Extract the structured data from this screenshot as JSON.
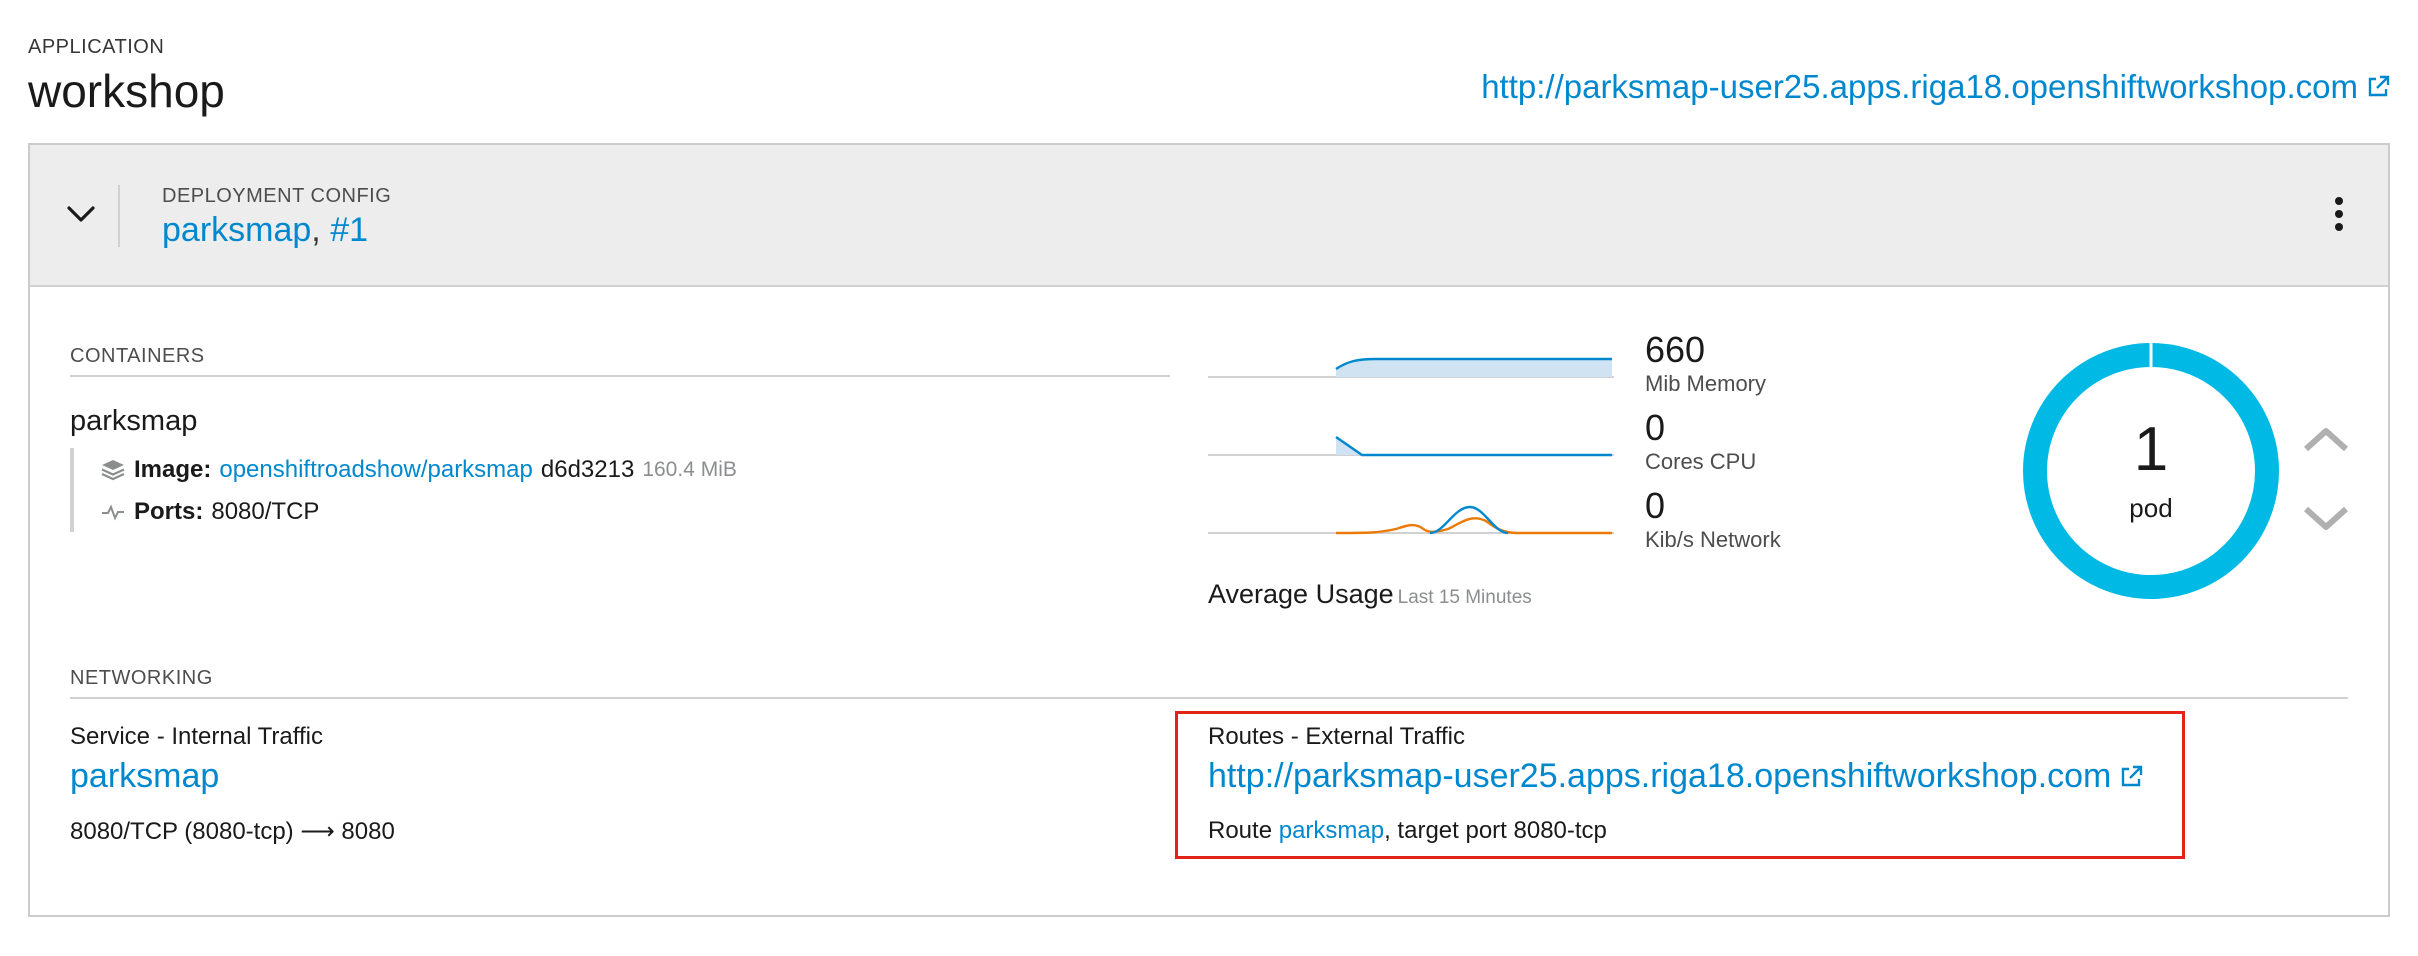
{
  "application": {
    "label": "APPLICATION",
    "name": "workshop",
    "url": "http://parksmap-user25.apps.riga18.openshiftworkshop.com"
  },
  "deployment": {
    "label": "DEPLOYMENT CONFIG",
    "name": "parksmap",
    "separator": ",",
    "revision": "#1"
  },
  "containers": {
    "label": "CONTAINERS",
    "name": "parksmap",
    "image_label": "Image:",
    "image_link": "openshiftroadshow/parksmap",
    "image_hash": "d6d3213",
    "image_size": "160.4 MiB",
    "ports_label": "Ports:",
    "ports_value": "8080/TCP"
  },
  "metrics": [
    {
      "value": "660",
      "unit": "Mib Memory"
    },
    {
      "value": "0",
      "unit": "Cores CPU"
    },
    {
      "value": "0",
      "unit": "Kib/s Network"
    }
  ],
  "average_usage": {
    "label": "Average Usage",
    "period": "Last 15 Minutes"
  },
  "pods": {
    "count": "1",
    "label": "pod",
    "ring_color": "#00b9e4"
  },
  "networking": {
    "label": "NETWORKING",
    "service": {
      "label": "Service - Internal Traffic",
      "name": "parksmap",
      "port_mapping": "8080/TCP (8080-tcp) ⟶ 8080"
    },
    "routes": {
      "label": "Routes - External Traffic",
      "url": "http://parksmap-user25.apps.riga18.openshiftworkshop.com",
      "route_prefix": "Route",
      "route_name": "parksmap",
      "route_suffix": ", target port 8080-tcp",
      "highlight_color": "#e2231a"
    }
  },
  "colors": {
    "link": "#0088ce",
    "sparkline_blue": "#0088ce",
    "sparkline_fill": "#cfe3f2",
    "sparkline_orange": "#ec7a08"
  }
}
